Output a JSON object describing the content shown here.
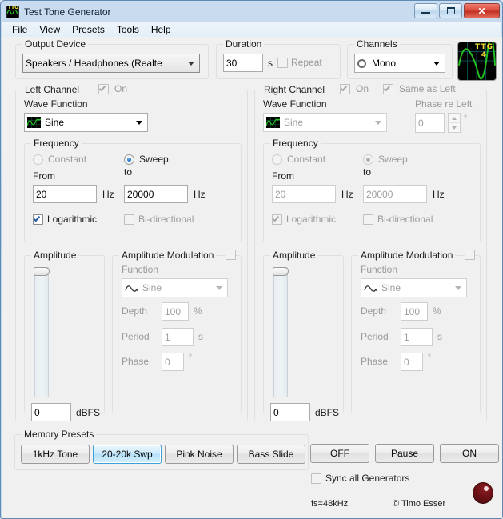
{
  "window": {
    "title": "Test Tone Generator",
    "icon": "ttg-app-icon",
    "buttons": {
      "minimize": "minimize",
      "maximize": "maximize",
      "close": "✕"
    }
  },
  "menubar": {
    "items": [
      {
        "label": "File",
        "accel": "F"
      },
      {
        "label": "View",
        "accel": "V"
      },
      {
        "label": "Presets",
        "accel": "P"
      },
      {
        "label": "Tools",
        "accel": "T"
      },
      {
        "label": "Help",
        "accel": "H"
      }
    ]
  },
  "output_device": {
    "group_label": "Output Device",
    "value": "Speakers / Headphones (Realte"
  },
  "duration": {
    "group_label": "Duration",
    "value": "30",
    "unit": "s",
    "repeat_label": "Repeat",
    "repeat_checked": false
  },
  "channels": {
    "group_label": "Channels",
    "value": "Mono"
  },
  "logo": {
    "line1": "TTG",
    "line2": "4"
  },
  "left_channel": {
    "group_label": "Left Channel",
    "on_label": "On",
    "on_checked": true,
    "wave_function_label": "Wave Function",
    "wave_function_value": "Sine",
    "frequency": {
      "group_label": "Frequency",
      "constant_label": "Constant",
      "sweep_label": "Sweep",
      "mode": "Sweep",
      "from_label": "From",
      "to_label": "to",
      "from_value": "20",
      "from_unit": "Hz",
      "to_value": "20000",
      "to_unit": "Hz",
      "logarithmic_label": "Logarithmic",
      "logarithmic_checked": true,
      "bidirectional_label": "Bi-directional",
      "bidirectional_checked": false
    },
    "amplitude": {
      "group_label": "Amplitude",
      "value": "0",
      "unit": "dBFS",
      "slider_position_pct": 100
    },
    "amplitude_modulation": {
      "group_label": "Amplitude Modulation",
      "enabled": false,
      "function_label": "Function",
      "function_value": "Sine",
      "depth_label": "Depth",
      "depth_value": "100",
      "depth_unit": "%",
      "period_label": "Period",
      "period_value": "1",
      "period_unit": "s",
      "phase_label": "Phase",
      "phase_value": "0",
      "phase_unit": "°"
    }
  },
  "right_channel": {
    "group_label": "Right Channel",
    "on_label": "On",
    "on_checked": true,
    "same_as_left_label": "Same as Left",
    "same_as_left_checked": true,
    "wave_function_label": "Wave Function",
    "wave_function_value": "Sine",
    "phase_re_left_label": "Phase re Left",
    "phase_re_left_value": "0",
    "phase_re_left_unit": "°",
    "frequency": {
      "group_label": "Frequency",
      "constant_label": "Constant",
      "sweep_label": "Sweep",
      "mode": "Sweep",
      "from_label": "From",
      "to_label": "to",
      "from_value": "20",
      "from_unit": "Hz",
      "to_value": "20000",
      "to_unit": "Hz",
      "logarithmic_label": "Logarithmic",
      "logarithmic_checked": true,
      "bidirectional_label": "Bi-directional",
      "bidirectional_checked": false
    },
    "amplitude": {
      "group_label": "Amplitude",
      "value": "0",
      "unit": "dBFS",
      "slider_position_pct": 100
    },
    "amplitude_modulation": {
      "group_label": "Amplitude Modulation",
      "enabled": false,
      "function_label": "Function",
      "function_value": "Sine",
      "depth_label": "Depth",
      "depth_value": "100",
      "depth_unit": "%",
      "period_label": "Period",
      "period_value": "1",
      "period_unit": "s",
      "phase_label": "Phase",
      "phase_value": "0",
      "phase_unit": "°"
    }
  },
  "memory_presets": {
    "group_label": "Memory Presets",
    "buttons": [
      {
        "label": "1kHz Tone",
        "focused": false
      },
      {
        "label": "20-20k Swp",
        "focused": true
      },
      {
        "label": "Pink Noise",
        "focused": false
      },
      {
        "label": "Bass Slide",
        "focused": false
      }
    ]
  },
  "transport": {
    "off_label": "OFF",
    "pause_label": "Pause",
    "on_label": "ON"
  },
  "sync": {
    "label": "Sync all Generators",
    "checked": false
  },
  "status": {
    "sample_rate": "fs=48kHz",
    "copyright": "© Timo Esser"
  },
  "colors": {
    "accent_blue": "#3c9fd6",
    "radio_blue": "#1c6fc4",
    "check_blue": "#2157a7",
    "scope_green": "#22c322",
    "scope_yellow": "#f1dd2e",
    "led_red": "#6d1216",
    "disabled_text": "#9a9a9a",
    "window_bg": "#f0f0f0"
  }
}
